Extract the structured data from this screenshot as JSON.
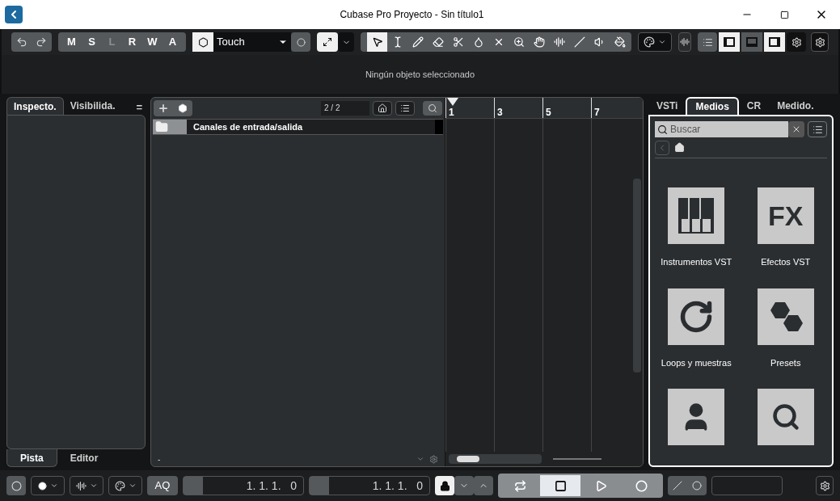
{
  "window": {
    "title": "Cubase Pro Proyecto - Sin título1"
  },
  "toolbar": {
    "modes": [
      {
        "label": "M",
        "disabled": false
      },
      {
        "label": "S",
        "disabled": false
      },
      {
        "label": "L",
        "disabled": true
      },
      {
        "label": "R",
        "disabled": false
      },
      {
        "label": "W",
        "disabled": false
      },
      {
        "label": "A",
        "disabled": false
      }
    ],
    "automation_mode": "Touch",
    "tools": [
      {
        "kind": "pointer",
        "selected": true
      },
      {
        "kind": "range",
        "selected": false
      },
      {
        "kind": "pencil",
        "selected": false
      },
      {
        "kind": "eraser",
        "selected": false
      },
      {
        "kind": "scissors",
        "selected": false
      },
      {
        "kind": "glue",
        "selected": false
      },
      {
        "kind": "mute",
        "selected": false
      },
      {
        "kind": "zoom",
        "selected": false
      },
      {
        "kind": "hand",
        "selected": false
      },
      {
        "kind": "comp",
        "selected": false
      },
      {
        "kind": "line",
        "selected": false
      },
      {
        "kind": "speaker",
        "selected": false
      },
      {
        "kind": "color",
        "selected": false
      }
    ],
    "zones": [
      {
        "kind": "left",
        "on": true
      },
      {
        "kind": "lower",
        "on": false
      },
      {
        "kind": "right",
        "on": true
      }
    ]
  },
  "info_line": "Ningún objeto seleccionado",
  "left_zone": {
    "tabs": [
      {
        "label": "Inspecto.",
        "selected": true
      },
      {
        "label": "Visibilida.",
        "selected": false
      }
    ],
    "menu_glyph": "=",
    "bottom_tabs": [
      {
        "label": "Pista",
        "selected": true
      },
      {
        "label": "Editor",
        "selected": false
      }
    ]
  },
  "track_list": {
    "count": "2 / 2",
    "tracks": [
      {
        "name": "Canales de entrada/salida"
      }
    ],
    "footer": "-"
  },
  "ruler": {
    "marks": [
      "1",
      "3",
      "5",
      "7"
    ]
  },
  "right_zone": {
    "tabs": [
      {
        "label": "VSTi",
        "selected": false
      },
      {
        "label": "Medios",
        "selected": true
      },
      {
        "label": "CR",
        "selected": false
      },
      {
        "label": "Medido.",
        "selected": false
      }
    ],
    "search": {
      "placeholder": "Buscar"
    },
    "effects_icon_text": "FX",
    "tiles": [
      {
        "kind": "piano",
        "label": "Instrumentos VST"
      },
      {
        "kind": "text",
        "label": "Efectos VST"
      },
      {
        "kind": "loop",
        "label": "Loops y muestras"
      },
      {
        "kind": "hexagons",
        "label": "Presets"
      },
      {
        "kind": "user"
      },
      {
        "kind": "browse"
      }
    ]
  },
  "transport": {
    "aq": "AQ",
    "left_locator": "1. 1. 1.   0",
    "right_locator": "1. 1. 1.   0",
    "buttons": [
      {
        "kind": "cycle",
        "selected": false
      },
      {
        "kind": "stop",
        "selected": true
      },
      {
        "kind": "play",
        "selected": false
      },
      {
        "kind": "record",
        "selected": false
      }
    ]
  }
}
